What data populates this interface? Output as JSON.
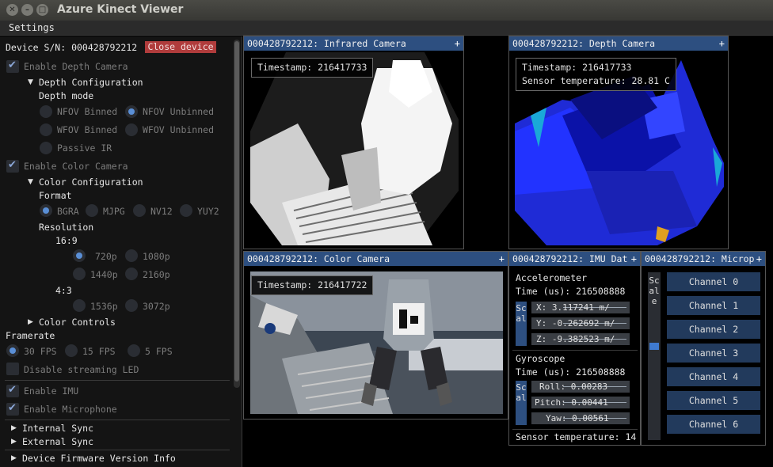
{
  "window": {
    "title": "Azure Kinect Viewer",
    "close_glyph": "✕",
    "min_glyph": "–",
    "max_glyph": "□"
  },
  "menu": {
    "settings": "Settings"
  },
  "left": {
    "device_sn_label": "Device S/N: 000428792212",
    "close_device": "Close device",
    "enable_depth": "Enable Depth Camera",
    "depth_config": "Depth Configuration",
    "depth_mode": "Depth mode",
    "nfov_binned": "NFOV Binned",
    "nfov_unbinned": "NFOV Unbinned",
    "wfov_binned": "WFOV Binned",
    "wfov_unbinned": "WFOV Unbinned",
    "passive_ir": "Passive IR",
    "enable_color": "Enable Color Camera",
    "color_config": "Color Configuration",
    "format": "Format",
    "bgra": "BGRA",
    "mjpg": "MJPG",
    "nv12": "NV12",
    "yuy2": "YUY2",
    "resolution": "Resolution",
    "ratio_16_9": "16:9",
    "r720": "720p",
    "r1080": "1080p",
    "r1440": "1440p",
    "r2160": "2160p",
    "ratio_4_3": "4:3",
    "r1536": "1536p",
    "r3072": "3072p",
    "color_controls": "Color Controls",
    "framerate": "Framerate",
    "fps30": "30 FPS",
    "fps15": "15 FPS",
    "fps5": "5 FPS",
    "disable_led": "Disable streaming LED",
    "enable_imu": "Enable IMU",
    "enable_mic": "Enable Microphone",
    "internal_sync": "Internal Sync",
    "external_sync": "External Sync",
    "firmware_info": "Device Firmware Version Info"
  },
  "ir": {
    "title": "000428792212: Infrared Camera",
    "timestamp": "Timestamp: 216417733"
  },
  "depth": {
    "title": "000428792212: Depth Camera",
    "timestamp": "Timestamp: 216417733",
    "sensor_temp": "Sensor temperature: 28.81 C"
  },
  "color": {
    "title": "000428792212: Color Camera",
    "timestamp": "Timestamp: 216417722"
  },
  "imu": {
    "title": "000428792212: IMU Dat",
    "accel_header": "Accelerometer",
    "accel_time": "Time (us): 216508888",
    "scale_label": "Scal",
    "x": "X:     3.117241 m/",
    "y": "Y:    -0.262692 m/",
    "z": "Z:    -9.382523 m/",
    "gyro_header": "Gyroscope",
    "gyro_time": "Time (us): 216508888",
    "roll": "Roll:     0.00283",
    "pitch": "Pitch:     0.00441",
    "yaw": "Yaw:     0.00561",
    "sensor_temp": "Sensor temperature: 14"
  },
  "mic": {
    "title": "000428792212: Microp",
    "scale_label": "Scale",
    "channels": [
      "Channel 0",
      "Channel 1",
      "Channel 2",
      "Channel 3",
      "Channel 4",
      "Channel 5",
      "Channel 6"
    ]
  },
  "plus": "+",
  "colors": {
    "accent": "#2d4f80",
    "close_btn": "#b03c3c",
    "panel": "#141414"
  }
}
